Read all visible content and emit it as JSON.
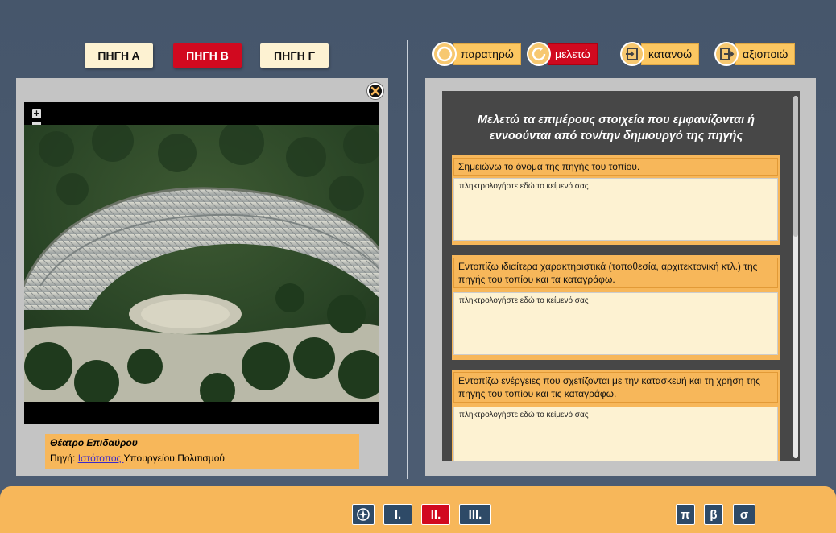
{
  "source_tabs": [
    {
      "label": "ΠΗΓΗ Α",
      "active": false
    },
    {
      "label": "ΠΗΓΗ Β",
      "active": true
    },
    {
      "label": "ΠΗΓΗ Γ",
      "active": false
    }
  ],
  "step_tabs": [
    {
      "label": "παρατηρώ",
      "icon": "circle-icon",
      "active": false
    },
    {
      "label": "μελετώ",
      "icon": "refresh-icon",
      "active": true
    },
    {
      "label": "κατανοώ",
      "icon": "enter-icon",
      "active": false
    },
    {
      "label": "αξιοποιώ",
      "icon": "exit-icon",
      "active": false
    }
  ],
  "viewer": {
    "zoom_in": "+",
    "zoom_out": "−",
    "caption_title": "Θέατρο Επιδαύρου",
    "caption_prefix": "Πηγή: ",
    "caption_link": "Ιστότοπος ",
    "caption_suffix": "Υπουργείου Πολιτισμού"
  },
  "form": {
    "heading": "Μελετώ τα επιμέρους στοιχεία που εμφανίζονται ή εννοούνται από τον/την δημιουργό της πηγής",
    "questions": [
      {
        "label": "Σημειώνω το όνομα της πηγής του τοπίου.",
        "placeholder": "πληκτρολογήστε εδώ το κείμενό σας"
      },
      {
        "label": "Εντοπίζω ιδιαίτερα χαρακτηριστικά (τοποθεσία, αρχιτεκτονική κτλ.) της πηγής του τοπίου και τα καταγράφω.",
        "placeholder": "πληκτρολογήστε εδώ το κείμενό σας"
      },
      {
        "label": "Εντοπίζω ενέργειες που σχετίζονται με την κατασκευή και τη χρήση της πηγής του τοπίου και τις καταγράφω.",
        "placeholder": "πληκτρολογήστε εδώ το κείμενό σας"
      }
    ]
  },
  "bottom_nav": {
    "sections": [
      {
        "label": "I.",
        "active": false
      },
      {
        "label": "II.",
        "active": true
      },
      {
        "label": "III.",
        "active": false
      }
    ],
    "tools": [
      "π",
      "β",
      "σ"
    ]
  },
  "colors": {
    "accent_red": "#d1091f",
    "panel_orange": "#f7b75a",
    "nav_blue": "#2e4a67",
    "background": "#4a5a70"
  }
}
